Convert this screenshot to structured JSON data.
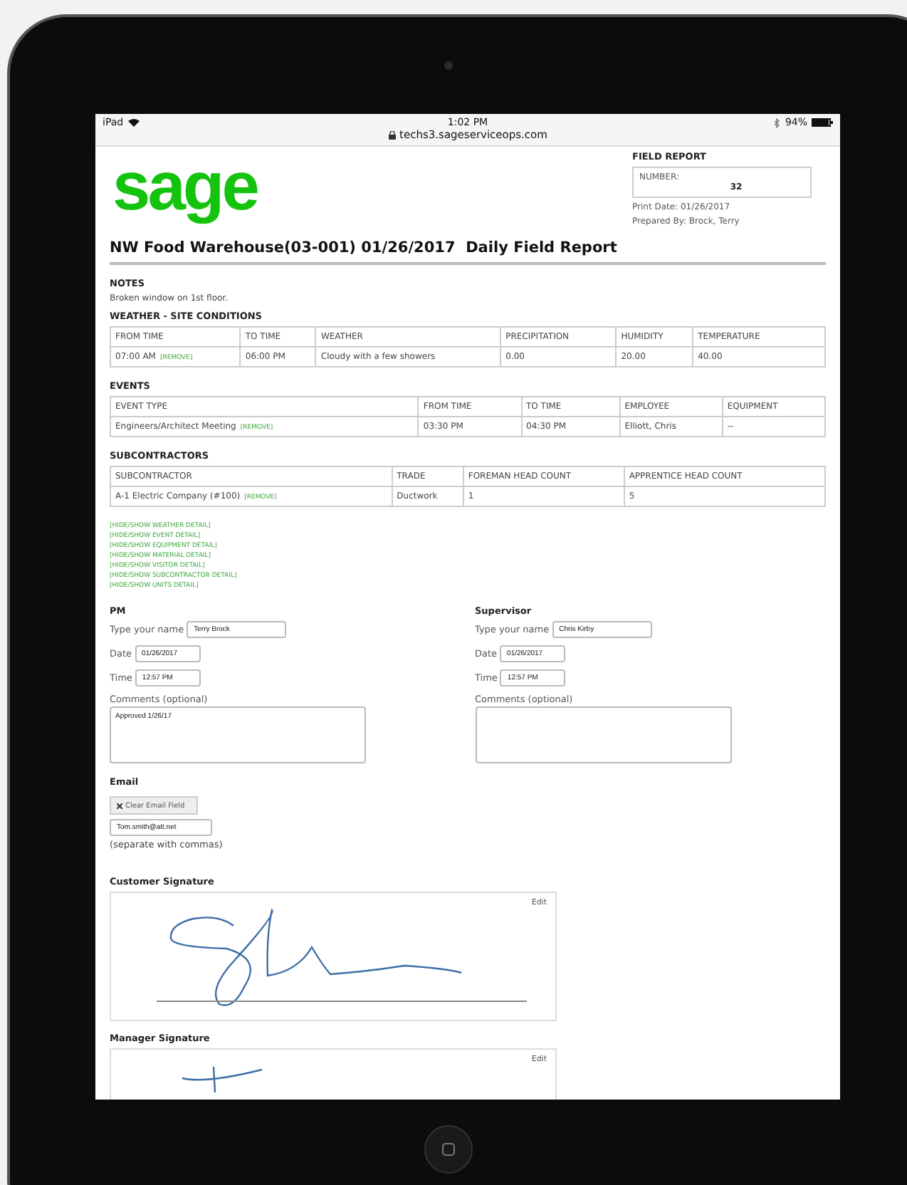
{
  "status_bar": {
    "device": "iPad",
    "time": "1:02 PM",
    "battery": "94%"
  },
  "address": "techs3.sageserviceops.com",
  "logo": "sage",
  "field_report": {
    "title": "FIELD REPORT",
    "number_label": "NUMBER:",
    "number": "32",
    "print_date": "Print Date: 01/26/2017",
    "prepared_by": "Prepared By: Brock, Terry"
  },
  "title": "NW Food Warehouse(03-001) 01/26/2017  Daily Field Report",
  "notes": {
    "heading": "NOTES",
    "text": "Broken window on 1st floor."
  },
  "tables": [
    {
      "heading": "WEATHER - SITE CONDITIONS",
      "columns": [
        "FROM TIME",
        "TO TIME",
        "WEATHER",
        "PRECIPITATION",
        "HUMIDITY",
        "TEMPERATURE"
      ],
      "rows": [
        {
          "cells": [
            "07:00 AM",
            "06:00 PM",
            "Cloudy with a few showers",
            "0.00",
            "20.00",
            "40.00"
          ],
          "remove": "[REMOVE]"
        }
      ]
    },
    {
      "heading": "EVENTS",
      "columns": [
        "EVENT TYPE",
        "FROM TIME",
        "TO TIME",
        "EMPLOYEE",
        "EQUIPMENT"
      ],
      "rows": [
        {
          "cells": [
            "Engineers/Architect Meeting",
            "03:30 PM",
            "04:30 PM",
            "Elliott, Chris",
            "--"
          ],
          "remove": "[REMOVE]"
        }
      ]
    },
    {
      "heading": "SUBCONTRACTORS",
      "columns": [
        "SUBCONTRACTOR",
        "TRADE",
        "FOREMAN HEAD COUNT",
        "APPRENTICE HEAD COUNT"
      ],
      "rows": [
        {
          "cells": [
            "A-1 Electric Company (#100)",
            "Ductwork",
            "1",
            "5"
          ],
          "remove": "[REMOVE]"
        }
      ]
    }
  ],
  "links": [
    "[HIDE/SHOW WEATHER DETAIL]",
    "[HIDE/SHOW EVENT DETAIL]",
    "[HIDE/SHOW EQUIPMENT DETAIL]",
    "[HIDE/SHOW MATERIAL DETAIL]",
    "[HIDE/SHOW VISITOR DETAIL]",
    "[HIDE/SHOW SUBCONTRACTOR DETAIL]",
    "[HIDE/SHOW UNITS DETAIL]"
  ],
  "approvals": [
    {
      "heading": "PM",
      "name_label": "Type your name",
      "name": "Terry Brock",
      "date_label": "Date",
      "date": "01/26/2017",
      "time_label": "Time",
      "time": "12:57 PM",
      "comments_label": "Comments (optional)",
      "comments": "Approved 1/26/17"
    },
    {
      "heading": "Supervisor",
      "name_label": "Type your name",
      "name": "Chris Kirby",
      "date_label": "Date",
      "date": "01/26/2017",
      "time_label": "Time",
      "time": "12:57 PM",
      "comments_label": "Comments (optional)"
    }
  ],
  "email": {
    "heading": "Email",
    "button": "Clear Email Field",
    "value": "Tom.smith@att.net",
    "hint": "(separate with commas)"
  },
  "signatures": [
    {
      "heading": "Customer Signature",
      "edit": "Edit"
    },
    {
      "heading": "Manager Signature",
      "edit": "Edit"
    }
  ]
}
